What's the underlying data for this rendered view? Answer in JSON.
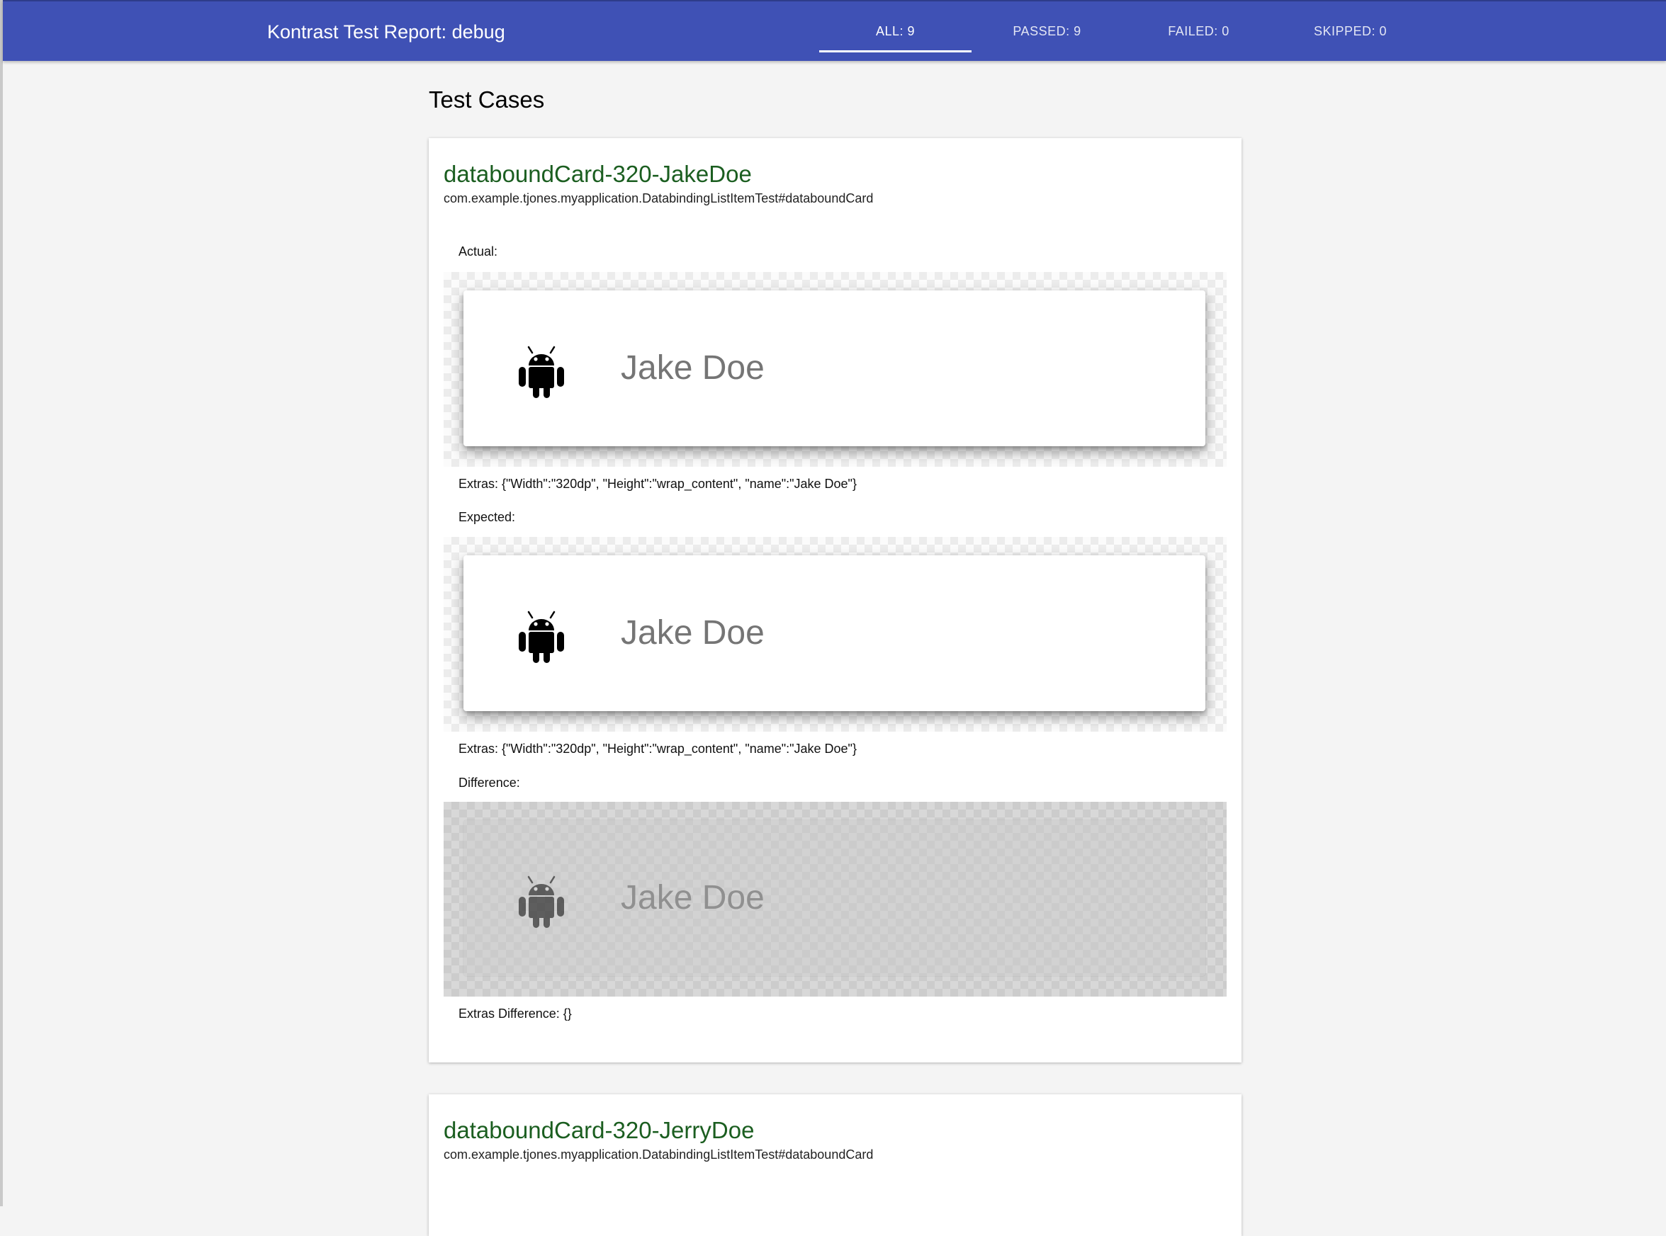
{
  "header": {
    "title": "Kontrast Test Report: debug",
    "tabs": [
      {
        "label": "ALL: 9",
        "active": true
      },
      {
        "label": "PASSED: 9",
        "active": false
      },
      {
        "label": "FAILED: 0",
        "active": false
      },
      {
        "label": "SKIPPED: 0",
        "active": false
      }
    ],
    "accent_color": "#3f51b5"
  },
  "main": {
    "heading": "Test Cases",
    "test_cases": [
      {
        "name": "databoundCard-320-JakeDoe",
        "class": "com.example.tjones.myapplication.DatabindingListItemTest#databoundCard",
        "name_color": "#1b5e20",
        "actual_label": "Actual:",
        "actual_item_name": "Jake Doe",
        "actual_extras": "Extras: {\"Width\":\"320dp\", \"Height\":\"wrap_content\", \"name\":\"Jake Doe\"}",
        "expected_label": "Expected:",
        "expected_item_name": "Jake Doe",
        "expected_extras": "Extras: {\"Width\":\"320dp\", \"Height\":\"wrap_content\", \"name\":\"Jake Doe\"}",
        "difference_label": "Difference:",
        "difference_item_name": "Jake Doe",
        "extras_difference": "Extras Difference: {}",
        "icon": "android-icon"
      },
      {
        "name": "databoundCard-320-JerryDoe",
        "class": "com.example.tjones.myapplication.DatabindingListItemTest#databoundCard",
        "name_color": "#1b5e20"
      }
    ]
  }
}
